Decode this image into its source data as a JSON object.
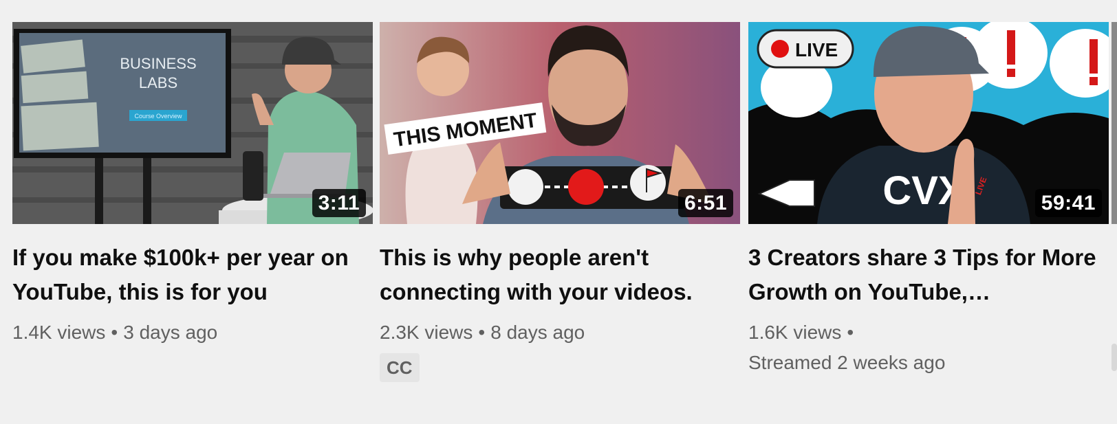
{
  "videos": [
    {
      "title": "If you make $100k+ per year on YouTube, this is for you",
      "duration": "3:11",
      "views": "1.4K views",
      "separator": "•",
      "age": "3 days ago",
      "thumbnail": {
        "screen_title_line1": "BUSINESS",
        "screen_title_line2": "LABS",
        "screen_button": "Course Overview"
      }
    },
    {
      "title": "This is why people aren't connecting with your videos.",
      "duration": "6:51",
      "views": "2.3K views",
      "separator": "•",
      "age": "8 days ago",
      "badge": "CC",
      "thumbnail": {
        "overlay_text": "THIS MOMENT"
      }
    },
    {
      "title": "3 Creators share 3 Tips for More Growth on YouTube,…",
      "duration": "59:41",
      "views": "1.6K views",
      "separator": "•",
      "age": "Streamed 2 weeks ago",
      "thumbnail": {
        "live_label": "LIVE",
        "shirt_text": "CVX",
        "shirt_small": "LIVE"
      }
    }
  ],
  "colors": {
    "background": "#f0f0f0",
    "title": "#0f0f0f",
    "meta": "#606060",
    "live_red": "#e01010"
  }
}
